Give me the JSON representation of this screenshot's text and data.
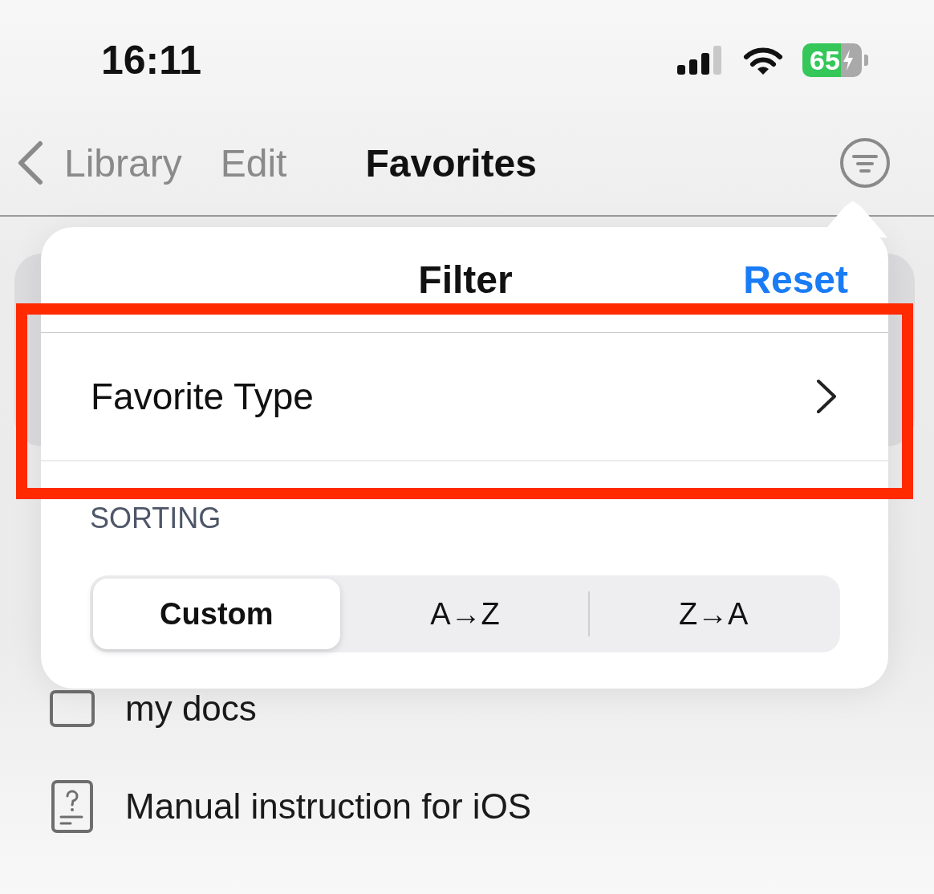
{
  "status_bar": {
    "time": "16:11",
    "battery": "65"
  },
  "nav": {
    "back": "Library",
    "edit": "Edit",
    "title": "Favorites"
  },
  "list": [
    {
      "kind": "folder",
      "label": "my docs"
    },
    {
      "kind": "manual",
      "label": "Manual instruction for iOS"
    }
  ],
  "filter_popover": {
    "title": "Filter",
    "reset": "Reset",
    "rows": [
      {
        "label": "Favorite Type"
      }
    ],
    "section": "SORTING",
    "sort_options": [
      {
        "label": "Custom",
        "selected": true
      },
      {
        "label": "A→Z",
        "selected": false
      },
      {
        "label": "Z→A",
        "selected": false
      }
    ]
  }
}
